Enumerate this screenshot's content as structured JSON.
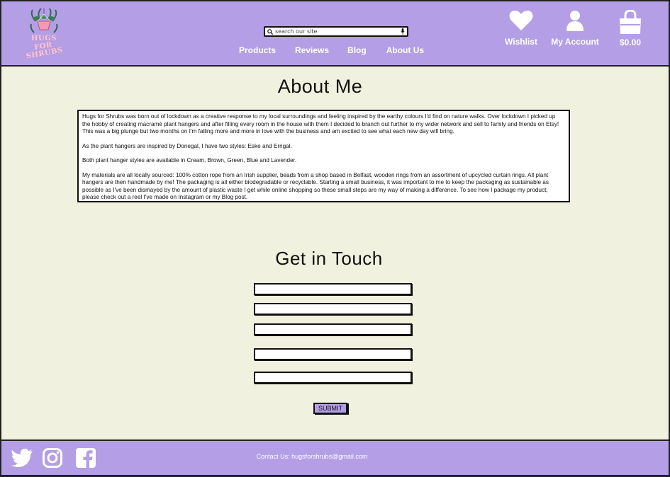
{
  "brand": {
    "logo_line1": "HUGS",
    "logo_line2": "FOR SHRUBS",
    "logo_icon": "hanging-plant-icon"
  },
  "colors": {
    "header_bg": "#b49ee6",
    "page_bg": "#f1f1df",
    "logo_pink": "#f7c9d6"
  },
  "search": {
    "placeholder": "search our site",
    "icon": "search-icon",
    "mic_icon": "microphone-icon"
  },
  "nav": {
    "items": [
      {
        "label": "Products"
      },
      {
        "label": "Reviews"
      },
      {
        "label": "Blog"
      },
      {
        "label": "About Us"
      }
    ]
  },
  "header_actions": {
    "wishlist": {
      "label": "Wishlist",
      "icon": "heart-icon"
    },
    "account": {
      "label": "My Account",
      "icon": "user-icon"
    },
    "cart": {
      "label": "$0.00",
      "icon": "shopping-bag-icon"
    }
  },
  "about": {
    "title": "About Me",
    "paragraphs": [
      "Hugs for Shrubs was born out of lockdown as a creative response to my local surroundings and feeling inspired by the earthy colours I'd find on nature walks. Over lockdown I picked up  the hobby of creating macramé plant hangers and after filling every room in the house with them I decided to branch out further to my wider network and sell to family and friends on Etsy! This was a big plunge but two months on I'm falling more and more in love with the business and am excited to see what each new day will bring.",
      "As the plant hangers are inspired by Donegal, I have two styles: Eske and Errigal.",
      "Both plant hanger styles are available in Cream, Brown, Green, Blue and Lavender.",
      "My materials are all locally sourced: 100% cotton rope from an Irish supplier, beads from a shop based in Belfast, wooden rings from an assortment of upcycled curtain rings. All plant hangers are then handmade by me! The packaging is all either biodegradable or recyclable. Starting a small business, it was important to me to keep the packaging as sustainable as possible as I've been dismayed by the amount of plastic waste I get while online shopping so these small steps are my way of making a difference. To see how I package my product, please check out a reel I've made on Instagram or my Blog post."
    ]
  },
  "contact": {
    "title": "Get in Touch",
    "fields": [
      "",
      "",
      "",
      "",
      ""
    ],
    "submit_label": "SUBMIT"
  },
  "footer": {
    "contact_text": "Contact Us: hugsforshrubs@gmail.com",
    "social": [
      "twitter-icon",
      "instagram-icon",
      "facebook-icon"
    ]
  }
}
